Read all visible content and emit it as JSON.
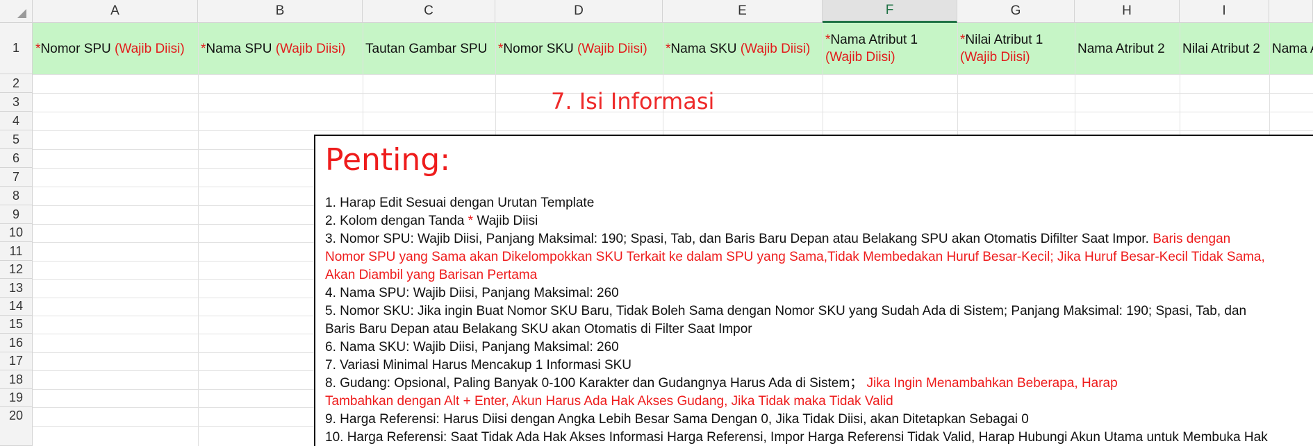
{
  "columns": [
    "A",
    "B",
    "C",
    "D",
    "E",
    "F",
    "G",
    "H",
    "I"
  ],
  "active_column": "F",
  "rows": [
    "1",
    "2",
    "3",
    "4",
    "5",
    "6",
    "7",
    "8",
    "9",
    "10",
    "11",
    "12",
    "13",
    "14",
    "15",
    "16",
    "17",
    "18",
    "19",
    "20"
  ],
  "header_row": {
    "a_star": "*",
    "a_label": "Nomor SPU ",
    "a_req": "(Wajib Diisi)",
    "b_star": "*",
    "b_label": "Nama SPU ",
    "b_req": "(Wajib Diisi)",
    "c_label": "Tautan Gambar SPU",
    "d_star": "*",
    "d_label": "Nomor SKU ",
    "d_req": "(Wajib Diisi)",
    "e_star": "*",
    "e_label": "Nama SKU ",
    "e_req": "(Wajib Diisi)",
    "f_star": "*",
    "f_label": "Nama Atribut 1",
    "f_req": "(Wajib Diisi)",
    "g_star": "*",
    "g_label": "Nilai Atribut 1",
    "g_req": "(Wajib Diisi)",
    "h_label": "Nama Atribut 2",
    "i_label": "Nilai Atribut 2",
    "j_label": "Nama A"
  },
  "section_title": "7. Isi Informasi",
  "note": {
    "title": "Penting:",
    "l1": "1. Harap Edit Sesuai dengan Urutan Template",
    "l2a": "2. Kolom dengan Tanda ",
    "l2b": "*",
    "l2c": " Wajib Diisi",
    "l3a": "3. Nomor SPU: Wajib Diisi, Panjang Maksimal: 190; Spasi, Tab, dan Baris Baru Depan atau Belakang SPU akan Otomatis Difilter Saat Impor. ",
    "l3b": "Baris dengan",
    "l3c": "Nomor SPU yang Sama akan Dikelompokkan SKU Terkait ke dalam SPU yang Sama,Tidak Membedakan Huruf Besar-Kecil; Jika Huruf Besar-Kecil Tidak Sama,",
    "l3d": "Akan Diambil yang Barisan Pertama",
    "l4": "4. Nama SPU: Wajib Diisi, Panjang Maksimal: 260",
    "l5a": "5. Nomor SKU: Jika ingin Buat Nomor SKU Baru, Tidak Boleh Sama dengan Nomor SKU yang Sudah Ada di Sistem; Panjang Maksimal: 190; Spasi, Tab, dan",
    "l5b": "Baris Baru Depan atau Belakang SKU akan Otomatis di Filter Saat Impor",
    "l6": "6. Nama SKU: Wajib Diisi, Panjang Maksimal: 260",
    "l7": "7. Variasi Minimal Harus Mencakup 1 Informasi SKU",
    "l8a": "8. Gudang: Opsional, Paling Banyak 0-100 Karakter dan Gudangnya Harus Ada di Sistem；",
    "l8b": "Jika Ingin Menambahkan Beberapa, Harap",
    "l8c": "Tambahkan dengan Alt + Enter, Akun Harus Ada Hak Akses Gudang, Jika Tidak maka Tidak Valid",
    "l9": "9. Harga Referensi: Harus Diisi dengan Angka Lebih Besar Sama Dengan 0, Jika Tidak Diisi, akan Ditetapkan Sebagai 0",
    "l10": "10. Harga Referensi: Saat Tidak Ada Hak Akses Informasi Harga Referensi, Impor Harga Referensi Tidak Valid, Harap Hubungi Akun Utama untuk Membuka Hak"
  },
  "colors": {
    "header_fill": "#c6f5c6",
    "required_red": "#e21b1b",
    "accent_green": "#217346"
  },
  "icons": {
    "select_all": "select-all-triangle-icon"
  }
}
